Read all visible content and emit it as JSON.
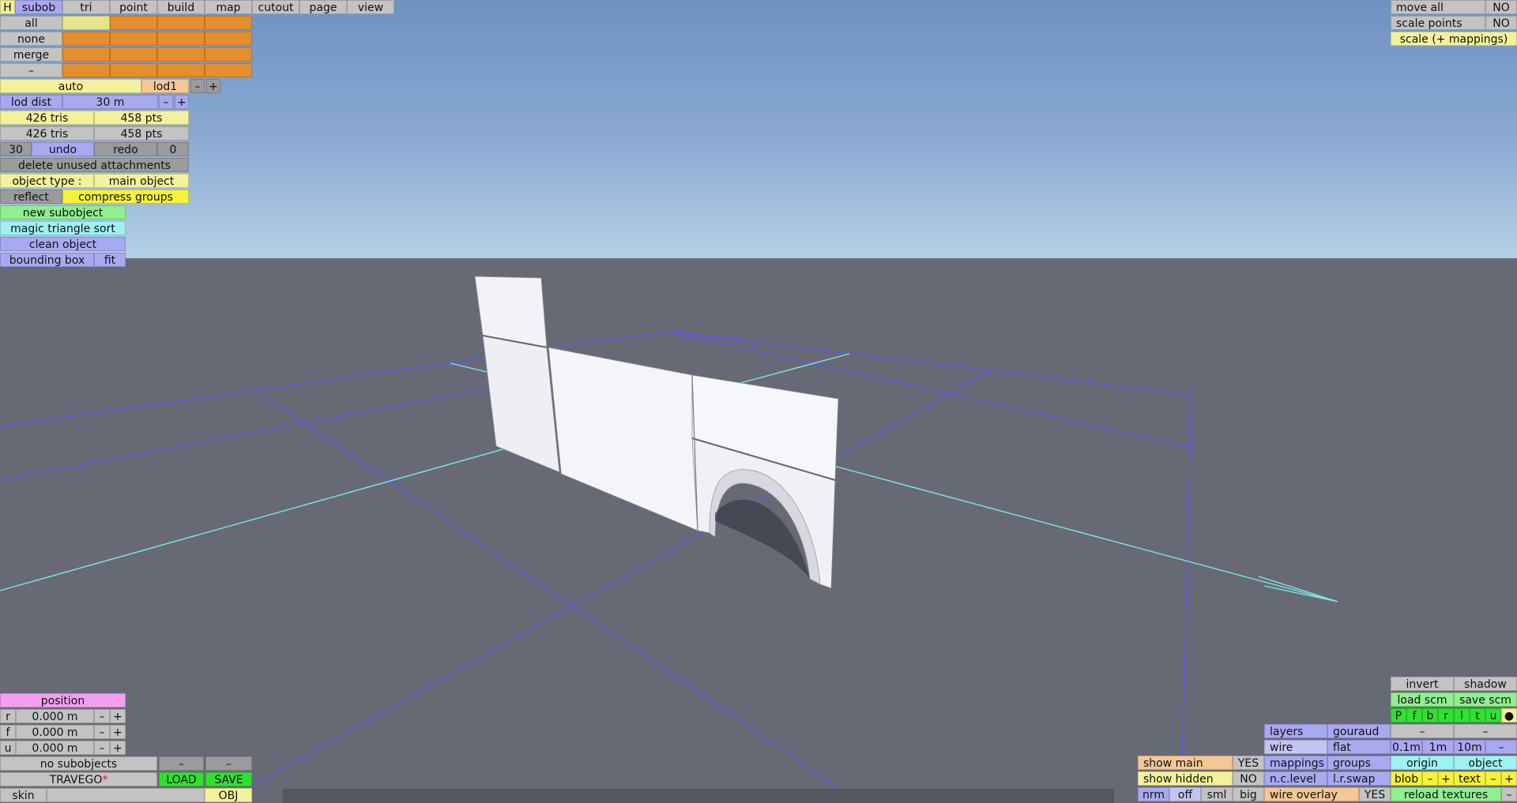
{
  "menu": {
    "h": "H",
    "tabs": [
      "subob",
      "tri",
      "point",
      "build",
      "map",
      "cutout",
      "page",
      "view"
    ]
  },
  "select": [
    "all",
    "none",
    "merge",
    "–"
  ],
  "lod": {
    "auto": "auto",
    "lod1": "lod1",
    "minus": "–",
    "plus": "+",
    "dist_label": "lod dist",
    "dist_value": "30 m",
    "dist_minus": "–",
    "dist_plus": "+"
  },
  "stats": {
    "tris1": "426 tris",
    "pts1": "458 pts",
    "tris2": "426 tris",
    "pts2": "458 pts"
  },
  "undo": {
    "count": "30",
    "undo": "undo",
    "redo": "redo",
    "redo_count": "0"
  },
  "actions": {
    "delete_unused": "delete unused attachments",
    "object_type_label": "object type :",
    "object_type_value": "main object",
    "reflect": "reflect",
    "compress_groups": "compress groups",
    "new_subobject": "new subobject",
    "magic_sort": "magic triangle sort",
    "clean_object": "clean object",
    "bounding_box": "bounding box",
    "fit": "fit"
  },
  "top_right": {
    "move_all": "move all",
    "move_all_val": "NO",
    "scale_points": "scale points",
    "scale_points_val": "NO",
    "scale_mappings": "scale (+ mappings)"
  },
  "position": {
    "title": "position",
    "rows": [
      {
        "axis": "r",
        "value": "0.000 m"
      },
      {
        "axis": "f",
        "value": "0.000 m"
      },
      {
        "axis": "u",
        "value": "0.000 m"
      }
    ],
    "minus": "–",
    "plus": "+"
  },
  "bottom_left": {
    "no_subobjects": "no subobjects",
    "minus": "–",
    "filename": "TRAVEGO",
    "modified": "*",
    "load": "LOAD",
    "save": "SAVE",
    "skin": "skin",
    "skin_value": "",
    "obj": "OBJ"
  },
  "bottom_right": {
    "invert": "invert",
    "shadow": "shadow",
    "load_scm": "load scm",
    "save_scm": "save scm",
    "views": [
      "P",
      "f",
      "b",
      "r",
      "l",
      "t",
      "u",
      "●"
    ],
    "layers": "layers",
    "gouraud": "gouraud",
    "minus": "–",
    "wire": "wire",
    "flat": "flat",
    "d01": "0.1m",
    "d1": "1m",
    "d10": "10m",
    "mappings": "mappings",
    "groups": "groups",
    "origin": "origin",
    "object": "object",
    "show_main": "show main",
    "show_main_val": "YES",
    "show_hidden": "show hidden",
    "show_hidden_val": "NO",
    "nc_level": "n.c.level",
    "lr_swap": "l.r.swap",
    "blob": "blob",
    "text": "text",
    "plus": "+",
    "nrm": "nrm",
    "off": "off",
    "sml": "sml",
    "big": "big",
    "wire_overlay": "wire overlay",
    "wire_overlay_val": "YES",
    "reload_textures": "reload textures"
  },
  "colors": {
    "sky_top": "#6f91c2",
    "ground": "#676a75",
    "grid": "#5a56f0",
    "axis": "#7de8e8",
    "model": "#f4f5f8"
  }
}
